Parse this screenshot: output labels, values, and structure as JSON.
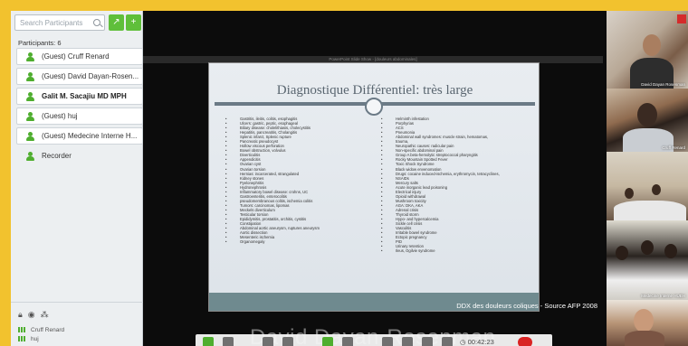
{
  "sidebar": {
    "search_placeholder": "Search Participants",
    "count_label": "Participants: 6",
    "participants": [
      {
        "name": "(Guest) Cruff Renard",
        "style": "boxed"
      },
      {
        "name": "(Guest) David Dayan-Rosen...",
        "style": "boxed"
      },
      {
        "name": "Galit M. Sacajiu MD MPH",
        "style": "bold"
      },
      {
        "name": "(Guest) huj",
        "style": "boxed"
      },
      {
        "name": "(Guest) Medecine Interne H...",
        "style": "boxed"
      },
      {
        "name": "Recorder",
        "style": "plain"
      }
    ],
    "speakers": [
      "Cruff Renard",
      "huj"
    ]
  },
  "main": {
    "window_title": "PowerPoint Slide Show - [douleurs abdominales]",
    "slide": {
      "title": "Diagnostique Différentiel: très large",
      "left_items": [
        "Gastritis, ileitis, colitis, esophagitis",
        "Ulcers: gastric, peptic, esophageal",
        "Biliary disease: cholelithiasis, cholecystitis",
        "Hepatitis, pancreatitis, Cholangitis",
        "Splenic infarct, Splenic rupture",
        "Pancreatic pseudocyst",
        "Hollow viscous perforation",
        "Bowel obstruction, volvulus",
        "Diverticulitis",
        "Appendicitis",
        "Ovarian cyst",
        "Ovarian torsion",
        "Hernias: incarcerated, strangulated",
        "Kidney stones",
        "Pyelonephritis",
        "Hydronephrosis",
        "Inflammatory bowel disease: crohns, UC",
        "Gastroenteritis, enterocolitis",
        "pseudomembranous colitis, ischemia colitis",
        "Tumors: carcinomas, lipomas",
        "Meckels diverticulum",
        "Testicular torsion",
        "Epididymitis, prostatitis, orchitis, cystitis",
        "Constipation",
        "Abdominal aortic aneurysm, ruptures aneurysm",
        "Aortic dissection",
        "Mesenteric ischemia",
        "Organomegaly"
      ],
      "right_items": [
        "Helminth infestation",
        "Porphyrias",
        "ACS",
        "Pneumonia",
        "Abdominal wall syndromes: muscle strain, hematomas,",
        "trauma,",
        "Neuropathic causes: radicular pain",
        "Non-specific abdominal pain",
        "Group A beta-hemolytic streptococcal pharyngitis",
        "Rocky Mountain Spotted Fever",
        "Toxic Shock Syndrome",
        "Black widow envenomation",
        "Drugs: cocaine induced-ischemia, erythromycin, tetracyclines,",
        "NSAIDs",
        "Mercury salts",
        "Acute inorganic lead poisoning",
        "Electrical injury",
        "Opioid withdrawal",
        "Mushroom toxicity",
        "AGA: DKA, AKA",
        "Adrenal crisis",
        "Thyroid storm",
        "Hypo- and hypercalcemia",
        "Sickle cell crisis",
        "Vasculitis",
        "Irritable bowel syndrome",
        "Ectopic pregnancy",
        "PID",
        "Urinary retention",
        "Ileus, Ogilvie syndrome"
      ]
    },
    "caption": "DDX des douleurs coliques - Source AFP 2008",
    "speaker_overlay": "David Dayan-Rosenman",
    "timer": "00:42:23"
  },
  "videos": [
    {
      "label": "David Dayan Rosenman"
    },
    {
      "label": "Cruff Renard"
    },
    {
      "label": ""
    },
    {
      "label": "Medecine Interne HUEH"
    },
    {
      "label": ""
    }
  ]
}
